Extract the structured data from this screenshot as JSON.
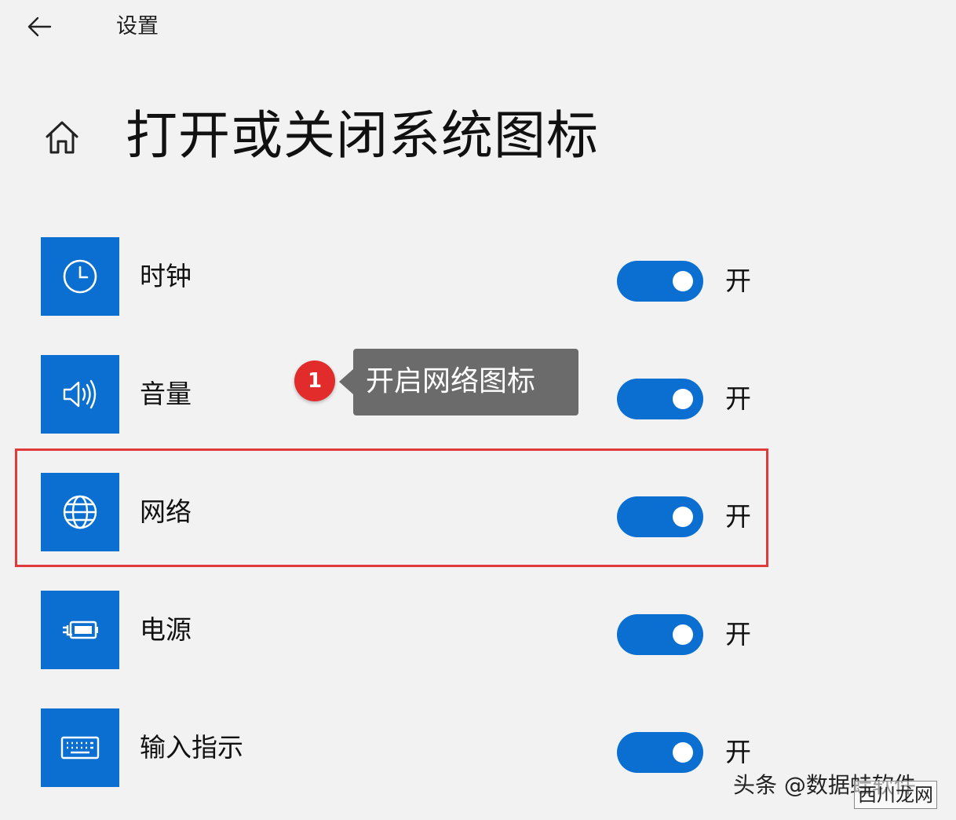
{
  "header": {
    "window_title": "设置"
  },
  "page": {
    "title": "打开或关闭系统图标"
  },
  "icons": {
    "back": "back-arrow-icon",
    "home": "home-icon"
  },
  "items": [
    {
      "label": "时钟",
      "icon": "clock-icon",
      "state": "开",
      "on": true
    },
    {
      "label": "音量",
      "icon": "volume-icon",
      "state": "开",
      "on": true
    },
    {
      "label": "网络",
      "icon": "network-globe-icon",
      "state": "开",
      "on": true
    },
    {
      "label": "电源",
      "icon": "power-battery-icon",
      "state": "开",
      "on": true
    },
    {
      "label": "输入指示",
      "icon": "keyboard-icon",
      "state": "开",
      "on": true
    }
  ],
  "annotation": {
    "step": "1",
    "text": "开启网络图标"
  },
  "watermark": {
    "text": "头条 @数据蛙软件",
    "text2": "西川龙网"
  },
  "colors": {
    "accent": "#0a6fd0",
    "highlight": "#e03a3a",
    "badge": "#e22b2b",
    "callout": "#6b6b6b"
  }
}
